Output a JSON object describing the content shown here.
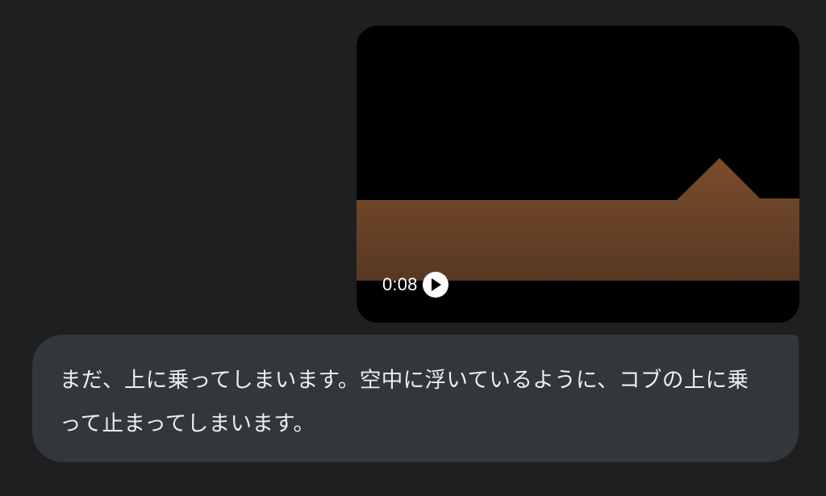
{
  "video": {
    "duration": "0:08",
    "play_icon": "play-icon",
    "colors": {
      "background": "#000000",
      "ground_top": "#7a4d2b",
      "ground_bottom": "#583823"
    }
  },
  "message": {
    "text": "まだ、上に乗ってしまいます。空中に浮いているように、コブの上に乗って止まってしまいます。"
  },
  "colors": {
    "page_background": "#1e1f21",
    "bubble_background": "#34373a",
    "text": "#eceef0"
  }
}
